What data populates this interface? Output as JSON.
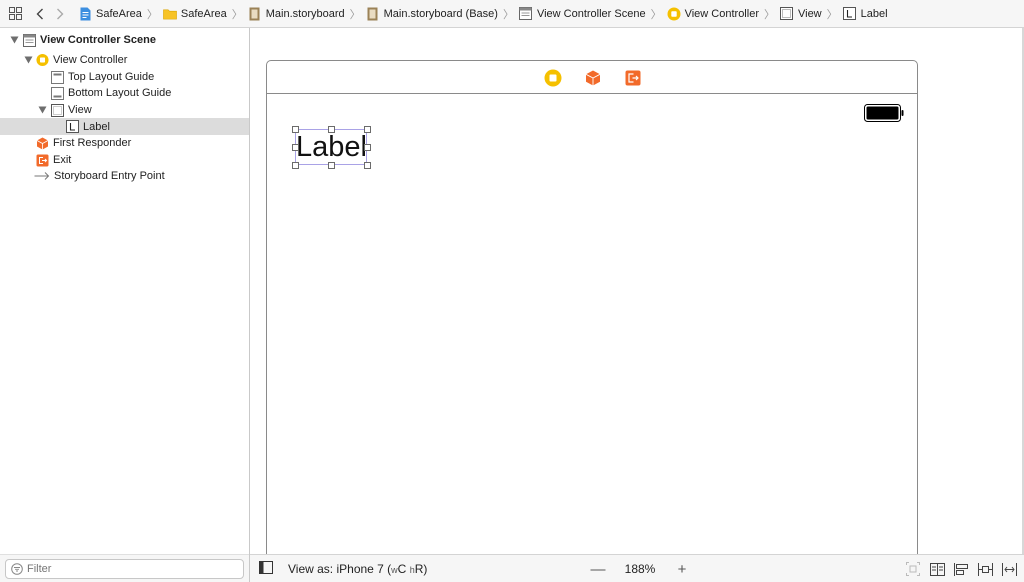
{
  "jumpbar": {
    "crumbs": [
      {
        "label": "SafeArea",
        "icon": "project-file-icon"
      },
      {
        "label": "SafeArea",
        "icon": "folder-icon"
      },
      {
        "label": "Main.storyboard",
        "icon": "storyboard-icon"
      },
      {
        "label": "Main.storyboard (Base)",
        "icon": "storyboard-icon"
      },
      {
        "label": "View Controller Scene",
        "icon": "scene-icon"
      },
      {
        "label": "View Controller",
        "icon": "view-controller-icon"
      },
      {
        "label": "View",
        "icon": "view-icon"
      },
      {
        "label": "Label",
        "icon": "label-icon"
      }
    ]
  },
  "outline": {
    "items": [
      {
        "label": "View Controller Scene",
        "icon": "scene-icon",
        "expanded": true
      },
      {
        "label": "View Controller",
        "icon": "view-controller-icon",
        "expanded": true
      },
      {
        "label": "Top Layout Guide",
        "icon": "top-layout-guide-icon"
      },
      {
        "label": "Bottom Layout Guide",
        "icon": "bottom-layout-guide-icon"
      },
      {
        "label": "View",
        "icon": "view-icon",
        "expanded": true
      },
      {
        "label": "Label",
        "icon": "label-icon",
        "selected": true
      },
      {
        "label": "First Responder",
        "icon": "first-responder-icon"
      },
      {
        "label": "Exit",
        "icon": "exit-icon"
      },
      {
        "label": "Storyboard Entry Point",
        "icon": "entry-arrow-icon"
      }
    ],
    "filter_placeholder": "Filter"
  },
  "canvas": {
    "label_text": "Label"
  },
  "bottombar": {
    "view_as_prefix": "View as: iPhone 7 (",
    "size_w": "w",
    "size_w_class": "C",
    "size_h": "h",
    "size_h_class": "R",
    "view_as_suffix": ")",
    "zoom_minus": "—",
    "zoom_level": "188%",
    "zoom_plus": "+"
  },
  "colors": {
    "vc_yellow": "#f5c000",
    "orange": "#f26a2a",
    "folder_yellow": "#f7c325",
    "storyboard_brown": "#9b8257",
    "selection": "#dcdcdc",
    "label_outline": "#a9a2e6"
  }
}
